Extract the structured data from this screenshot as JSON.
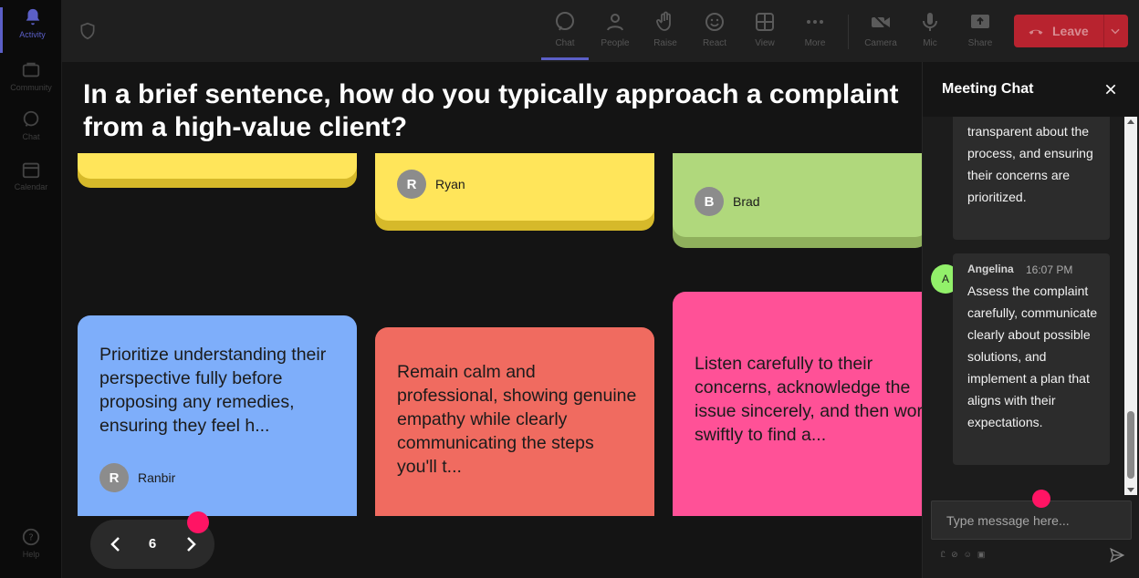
{
  "rail": {
    "items": [
      {
        "label": "Activity",
        "icon": "bell-icon"
      },
      {
        "label": "Community",
        "icon": "community-icon"
      },
      {
        "label": "Chat",
        "icon": "chat-icon"
      },
      {
        "label": "Calendar",
        "icon": "calendar-icon"
      }
    ],
    "help_label": "Help"
  },
  "toolbar": {
    "buttons": [
      {
        "label": "Chat",
        "icon": "chat-icon"
      },
      {
        "label": "People",
        "icon": "people-icon"
      },
      {
        "label": "Raise",
        "icon": "raise-hand-icon"
      },
      {
        "label": "React",
        "icon": "react-icon"
      },
      {
        "label": "View",
        "icon": "view-icon"
      },
      {
        "label": "More",
        "icon": "more-icon"
      },
      {
        "label": "Camera",
        "icon": "camera-off-icon"
      },
      {
        "label": "Mic",
        "icon": "mic-icon"
      },
      {
        "label": "Share",
        "icon": "share-icon"
      }
    ],
    "leave_label": "Leave",
    "leave_color": "#b8232f"
  },
  "board": {
    "question": "In a brief sentence, how do you typically approach a complaint from a high-value client?",
    "notes": [
      {
        "text": "",
        "author": "",
        "initial": "",
        "color": "#ffe55a"
      },
      {
        "text": "",
        "author": "Ryan",
        "initial": "R",
        "color": "#ffe55a"
      },
      {
        "text": "",
        "author": "Brad",
        "initial": "B",
        "color": "#b0d87c"
      },
      {
        "text": "Prioritize understanding their perspective fully before proposing any remedies, ensuring they feel h...",
        "author": "Ranbir",
        "initial": "R",
        "color": "#7eaefa"
      },
      {
        "text": "Remain calm and professional, showing genuine empathy while clearly communicating the steps you'll t...",
        "author": "",
        "initial": "",
        "color": "#f06b60"
      },
      {
        "text": "Listen carefully to their concerns, acknowledge the issue sincerely, and then work swiftly to find a...",
        "author": "",
        "initial": "",
        "color": "#ff5197"
      }
    ],
    "pager": {
      "page": "6"
    }
  },
  "chat": {
    "title": "Meeting Chat",
    "messages": [
      {
        "sender": "",
        "time": "",
        "text": "transparent about the process, and ensuring their concerns are prioritized."
      },
      {
        "sender": "Angelina",
        "initial": "A",
        "time": "16:07 PM",
        "text": "Assess the complaint carefully, communicate clearly about possible solutions, and implement a plan that aligns with their expectations."
      }
    ],
    "input_placeholder": "Type message here...",
    "tools": [
      "Ꮭ",
      "⊘",
      "☺",
      "▣"
    ]
  },
  "colors": {
    "accent": "#5b5fc7",
    "highlight_dot": "#ff1464"
  }
}
